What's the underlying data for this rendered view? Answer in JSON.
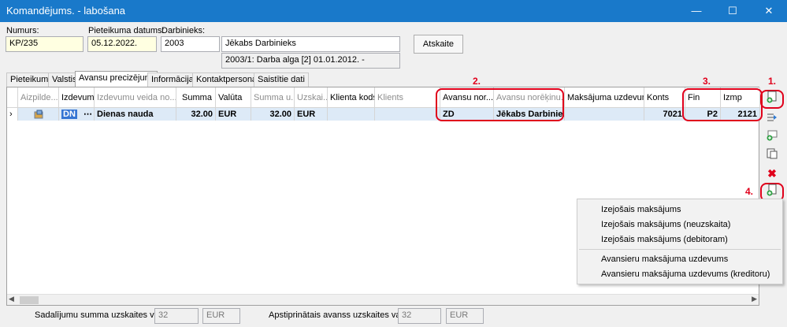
{
  "window": {
    "title": "Komandējums. - labošana",
    "minimize": "—",
    "maximize": "☐",
    "close": "✕"
  },
  "form": {
    "number_label": "Numurs:",
    "number_value": "KP/235",
    "date_label": "Pieteikuma datums:",
    "date_value": "05.12.2022.",
    "employee_label": "Darbinieks:",
    "employee_code": "2003",
    "employee_name": "Jēkabs Darbinieks",
    "employee_info": "2003/1: Darba alga [2] 01.01.2012. -",
    "report_button": "Atskaite"
  },
  "tabs": [
    "Pieteikums",
    "Valstis",
    "Avansu precizējumi",
    "Informācija",
    "Kontaktpersonas",
    "Saistītie dati"
  ],
  "active_tab": 2,
  "grid": {
    "columns": [
      "Aizpilde...",
      "Izdevum...",
      "Izdevumu veida no...",
      "Summa",
      "Valūta",
      "Summa u...",
      "Uzskai...",
      "Klienta kods",
      "Klients",
      "Avansu nor...",
      "Avansu norēķinu...",
      "Maksājuma uzdevums",
      "Konts",
      "Fin",
      "Izmp"
    ],
    "row": {
      "expense_code": "DN",
      "expense_name": "Dienas nauda",
      "amount": "32.00",
      "currency": "EUR",
      "amount2": "32.00",
      "currency2": "EUR",
      "client_code": "",
      "client": "",
      "advance_code": "ZD",
      "advance_name": "Jēkabs Darbinieks",
      "payment": "",
      "account": "7021",
      "fin": "P2",
      "izmp": "2121"
    }
  },
  "annotations": [
    "1.",
    "2.",
    "3.",
    "4."
  ],
  "context_menu": [
    "Izejošais maksājums",
    "Izejošais  maksājums (neuzskaita)",
    "Izejošais  maksājums (debitoram)",
    "Avansieru maksājuma uzdevums",
    "Avansieru maksājuma uzdevums (kreditoru)"
  ],
  "footer": {
    "sum_label": "Sadalījumu summa uzskaites valūtā:",
    "sum_value": "32",
    "sum_currency": "EUR",
    "approved_label": "Apstiprinātais avanss uzskaites valūtā:",
    "approved_value": "32",
    "approved_currency": "EUR"
  },
  "colors": {
    "titlebar": "#1979ca",
    "highlight": "#e0001b",
    "selected_row": "#ddeaf7"
  }
}
